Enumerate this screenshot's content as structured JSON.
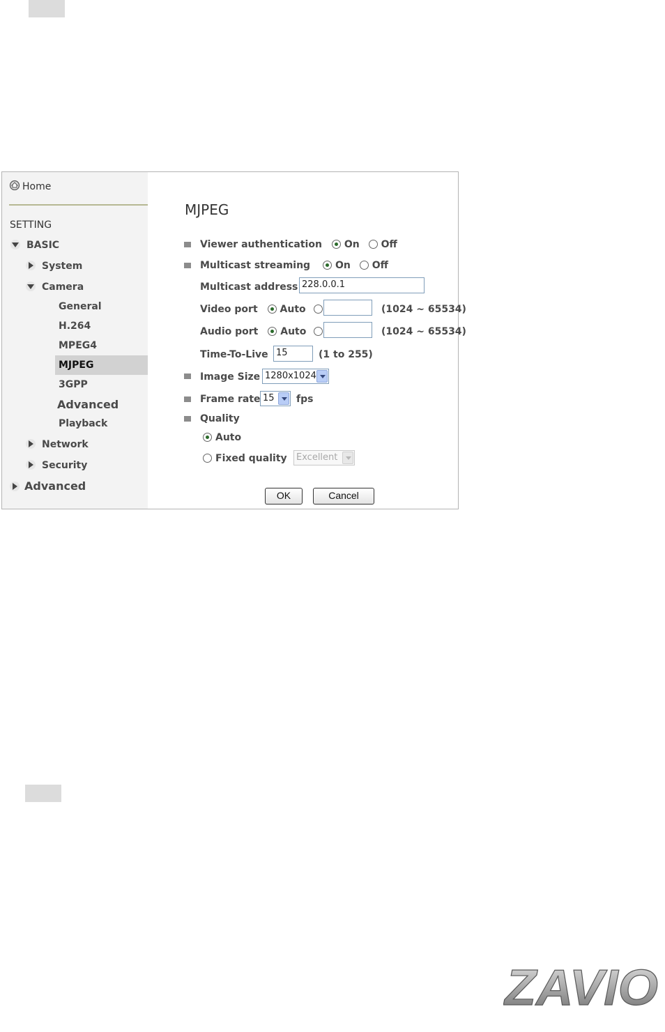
{
  "sidebar": {
    "home": "Home",
    "setting": "SETTING",
    "basic": "BASIC",
    "system": "System",
    "camera": "Camera",
    "general": "General",
    "h264": "H.264",
    "mpeg4": "MPEG4",
    "mjpeg": "MJPEG",
    "threegpp": "3GPP",
    "advanced_sub": "Advanced",
    "playback": "Playback",
    "network": "Network",
    "security": "Security",
    "advanced": "Advanced"
  },
  "form": {
    "title": "MJPEG",
    "viewer_auth": {
      "label": "Viewer authentication",
      "on": "On",
      "off": "Off",
      "selected": "On"
    },
    "multicast": {
      "label": "Multicast streaming",
      "on": "On",
      "off": "Off",
      "selected": "On"
    },
    "multicast_address": {
      "label": "Multicast address",
      "value": "228.0.0.1"
    },
    "video_port": {
      "label": "Video port",
      "auto": "Auto",
      "range": "(1024 ~ 65534)",
      "value": ""
    },
    "audio_port": {
      "label": "Audio port",
      "auto": "Auto",
      "range": "(1024 ~ 65534)",
      "value": ""
    },
    "ttl": {
      "label": "Time-To-Live",
      "value": "15",
      "range": "(1 to 255)"
    },
    "image_size": {
      "label": "Image Size",
      "value": "1280x1024"
    },
    "frame_rate": {
      "label": "Frame rate",
      "value": "15",
      "unit": "fps"
    },
    "quality": {
      "label": "Quality",
      "auto": "Auto",
      "fixed": "Fixed quality",
      "fixed_value": "Excellent",
      "selected": "Auto"
    },
    "ok": "OK",
    "cancel": "Cancel"
  },
  "logo_text": "ZAVIO"
}
